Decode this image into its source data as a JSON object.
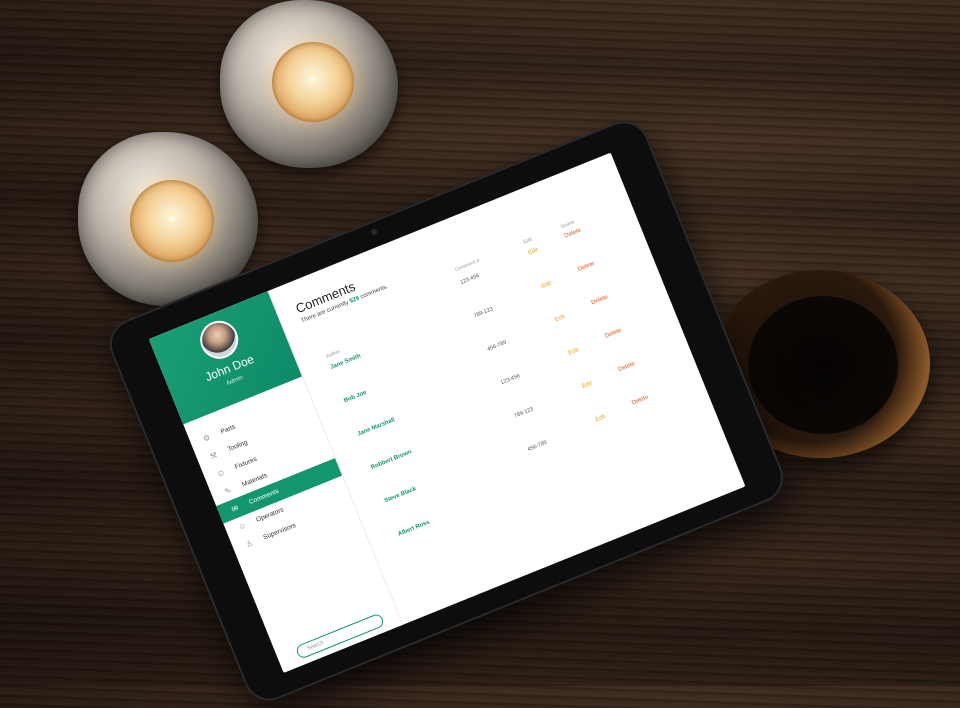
{
  "sidebar": {
    "user": {
      "name": "John Doe",
      "role": "Admin"
    },
    "items": [
      {
        "label": "Parts",
        "icon": "gear-icon",
        "glyph": "⚙",
        "active": false
      },
      {
        "label": "Tooling",
        "icon": "tools-icon",
        "glyph": "⚒",
        "active": false
      },
      {
        "label": "Fixtures",
        "icon": "fixture-icon",
        "glyph": "⊙",
        "active": false
      },
      {
        "label": "Materials",
        "icon": "pencil-icon",
        "glyph": "✎",
        "active": false
      },
      {
        "label": "Comments",
        "icon": "comment-icon",
        "glyph": "✉",
        "active": true
      },
      {
        "label": "Operators",
        "icon": "operator-icon",
        "glyph": "☺",
        "active": false
      },
      {
        "label": "Supervisors",
        "icon": "supervisor-icon",
        "glyph": "♙",
        "active": false
      }
    ],
    "search_placeholder": "Search"
  },
  "main": {
    "title": "Comments",
    "subtitle_pre": "There are currently",
    "subtitle_count": "$29",
    "subtitle_post": "comments.",
    "headers": {
      "author": "Author",
      "number": "Comment #",
      "edit": "Edit",
      "delete": "Delete"
    },
    "rows": [
      {
        "author": "Jane Smith",
        "number": "123-456",
        "edit": "Edit",
        "delete": "Delete"
      },
      {
        "author": "Bob Joe",
        "number": "789-123",
        "edit": "Edit",
        "delete": "Delete"
      },
      {
        "author": "Jane Marshall",
        "number": "456-789",
        "edit": "Edit",
        "delete": "Delete"
      },
      {
        "author": "Robbert Brown",
        "number": "123-456",
        "edit": "Edit",
        "delete": "Delete"
      },
      {
        "author": "Steve Black",
        "number": "789-123",
        "edit": "Edit",
        "delete": "Delete"
      },
      {
        "author": "Albert Ross",
        "number": "456-789",
        "edit": "Edit",
        "delete": "Delete"
      }
    ]
  },
  "colors": {
    "brand": "#13966f",
    "edit": "#f0a41a",
    "delete": "#e5571c"
  }
}
